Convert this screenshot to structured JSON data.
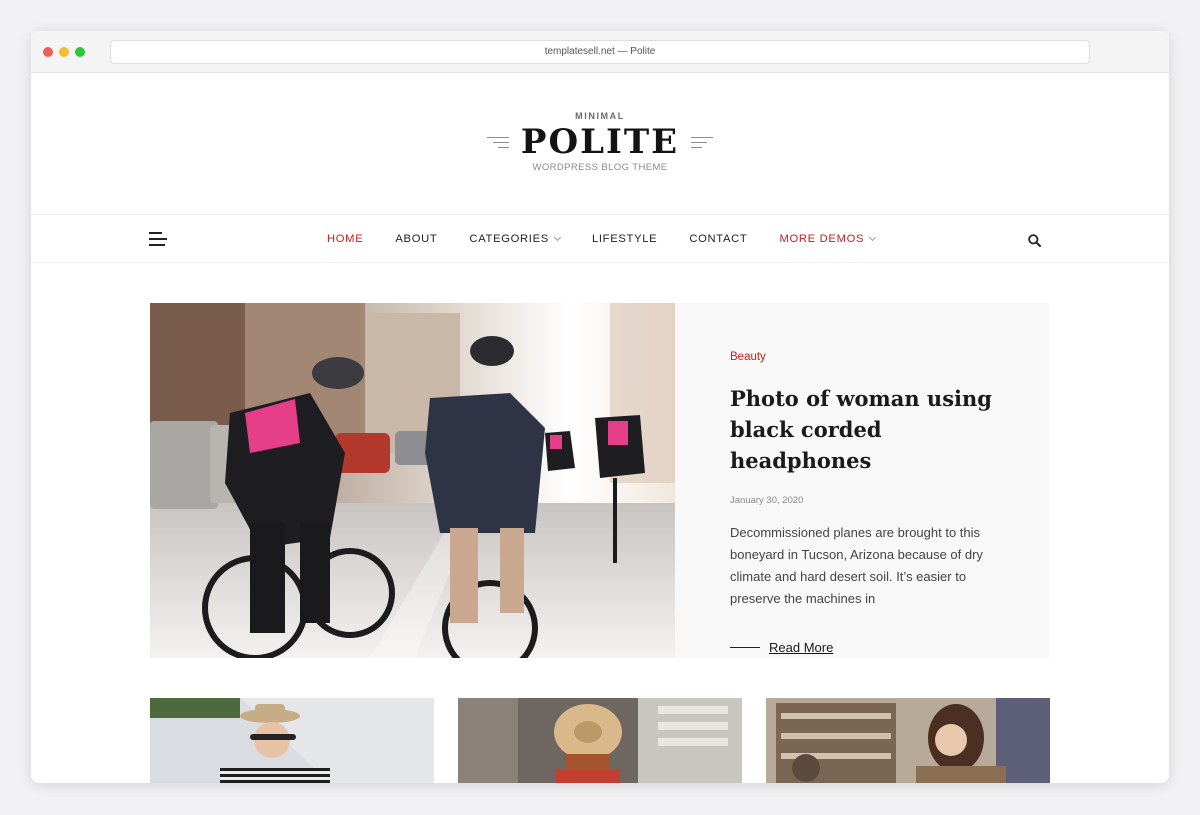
{
  "browser": {
    "url_text": "templatesell.net — Polite"
  },
  "logo": {
    "overline": "MINIMAL",
    "name": "POLITE",
    "tagline": "WORDPRESS BLOG THEME"
  },
  "nav": {
    "items": [
      {
        "label": "HOME",
        "active": true,
        "dropdown": false
      },
      {
        "label": "ABOUT",
        "active": false,
        "dropdown": false
      },
      {
        "label": "CATEGORIES",
        "active": false,
        "dropdown": true
      },
      {
        "label": "LIFESTYLE",
        "active": false,
        "dropdown": false
      },
      {
        "label": "CONTACT",
        "active": false,
        "dropdown": false
      },
      {
        "label": "MORE DEMOS",
        "active": true,
        "dropdown": true
      }
    ],
    "menu_icon": "hamburger-menu-icon",
    "search_icon": "search-icon"
  },
  "featured": {
    "category": "Beauty",
    "title": "Photo of woman using black corded headphones",
    "date": "January 30, 2020",
    "excerpt": "Decommissioned planes are brought to this boneyard in Tucson, Arizona because of dry climate and hard desert soil. It’s easier to preserve the machines in",
    "read_more": "Read More"
  },
  "colors": {
    "accent": "#c0211b",
    "text": "#222222",
    "featured_bg": "#f8f8f8"
  }
}
